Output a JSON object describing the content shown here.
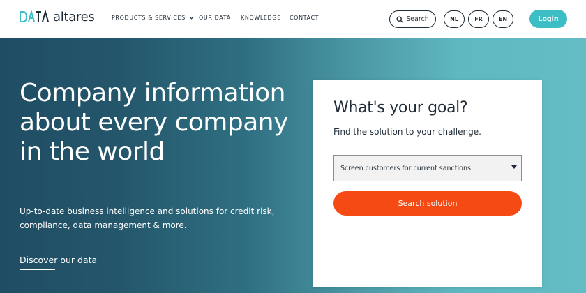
{
  "brand": {
    "logo_mark": "DATA",
    "name": "altares"
  },
  "nav": {
    "items": [
      {
        "label": "PRODUCTS & SERVICES",
        "has_dropdown": true
      },
      {
        "label": "OUR DATA"
      },
      {
        "label": "KNOWLEDGE"
      },
      {
        "label": "CONTACT"
      }
    ]
  },
  "header": {
    "search_label": "Search",
    "languages": [
      "NL",
      "FR",
      "EN"
    ],
    "login_label": "Login"
  },
  "hero": {
    "title": "Company information about every company in the world",
    "subtitle": "Up-to-date business intelligence and solutions for credit risk, compliance, data management & more.",
    "cta_label": "Discover our data"
  },
  "goal_card": {
    "title": "What's your goal?",
    "subtitle": "Find the solution to your challenge.",
    "select_value": "Screen customers for current sanctions",
    "button_label": "Search solution"
  },
  "colors": {
    "primary_teal": "#3dbdc4",
    "accent_orange": "#f54a14",
    "dark_text": "#1f2b36",
    "hero_start": "#1f4d64",
    "hero_end": "#64bdc4"
  },
  "icons": {
    "search": "magnifier-icon",
    "dropdown": "chevron-down-icon",
    "select_arrow": "caret-down-icon"
  }
}
